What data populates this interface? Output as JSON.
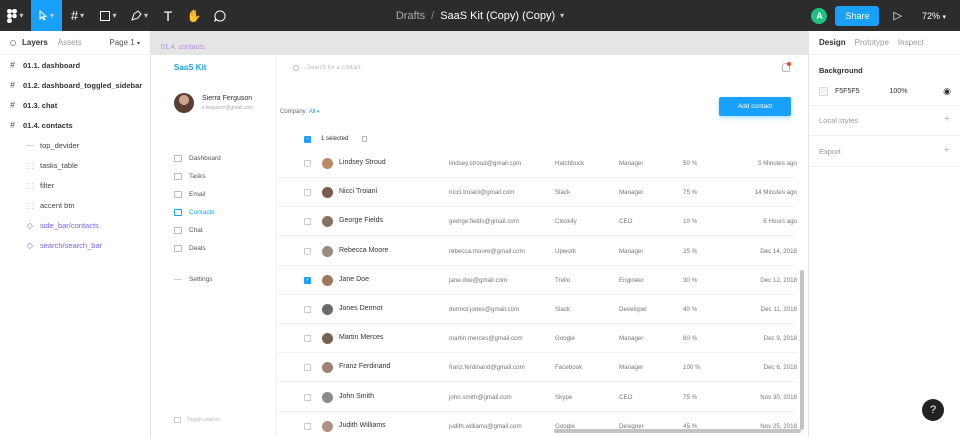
{
  "toolbar": {
    "tools": [
      "figma-menu",
      "move",
      "frame",
      "shape",
      "pen",
      "text",
      "hand",
      "comment"
    ],
    "text_tool_glyph": "T",
    "drafts": "Drafts",
    "separator": "/",
    "file_name": "SaaS Kit (Copy) (Copy)",
    "avatar_letter": "A",
    "share_label": "Share",
    "zoom": "72%"
  },
  "left_panel": {
    "tab_layers": "Layers",
    "tab_assets": "Assets",
    "page": "Page 1",
    "layers": [
      {
        "label": "01.1. dashboard",
        "kind": "frame"
      },
      {
        "label": "01.2. dashboard_toggled_sidebar",
        "kind": "frame"
      },
      {
        "label": "01.3. chat",
        "kind": "frame"
      },
      {
        "label": "01.4. contacts",
        "kind": "frame"
      },
      {
        "label": "top_devider",
        "kind": "line"
      },
      {
        "label": "tasks_table",
        "kind": "group"
      },
      {
        "label": "filter",
        "kind": "group"
      },
      {
        "label": "accent btn",
        "kind": "group"
      },
      {
        "label": "side_bar/contacts",
        "kind": "component"
      },
      {
        "label": "search/search_bar",
        "kind": "component"
      }
    ]
  },
  "canvas": {
    "frame_label": "01.4. contacts",
    "logo": "SaaS Kit",
    "profile": {
      "name": "Sierra Ferguson",
      "email": "s.ferguson@gmail.com"
    },
    "nav": [
      {
        "label": "Dashboard",
        "active": false
      },
      {
        "label": "Tasks",
        "active": false
      },
      {
        "label": "Email",
        "active": false
      },
      {
        "label": "Contacts",
        "active": true
      },
      {
        "label": "Chat",
        "active": false
      },
      {
        "label": "Deals",
        "active": false
      },
      {
        "label": "Settings",
        "active": false
      }
    ],
    "toggle_sidebar": "Toggle sidebar",
    "search_placeholder": "Search for a contact",
    "company_label": "Company:",
    "company_value": "All",
    "add_button": "Add contact",
    "selected_text": "1 selected",
    "contacts": [
      {
        "name": "Lindsey Stroud",
        "email": "lindsey.stroud@gmail.com",
        "company": "Hatchbuck",
        "role": "Manager",
        "percent": "50 %",
        "time": "5 Minutes ago",
        "checked": false,
        "avatar": "#b88a6a"
      },
      {
        "name": "Nicci Troiani",
        "email": "nicci.troiani@gmail.com",
        "company": "Slack",
        "role": "Manager",
        "percent": "75 %",
        "time": "14 Minutes ago",
        "checked": false,
        "avatar": "#7a5c4c"
      },
      {
        "name": "George Fields",
        "email": "george.fields@gmail.com",
        "company": "Clockify",
        "role": "CEO",
        "percent": "10 %",
        "time": "6 Hours ago",
        "checked": false,
        "avatar": "#8a7060"
      },
      {
        "name": "Rebecca Moore",
        "email": "rebecca.moore@gmail.com",
        "company": "Upwork",
        "role": "Manager",
        "percent": "25 %",
        "time": "Dec 14, 2018",
        "checked": false,
        "avatar": "#9a8a80"
      },
      {
        "name": "Jane Doe",
        "email": "jane.doe@gmail.com",
        "company": "Trello",
        "role": "Engineer",
        "percent": "30 %",
        "time": "Dec 12, 2018",
        "checked": true,
        "avatar": "#a07860"
      },
      {
        "name": "Jones Dermot",
        "email": "dermot.jones@gmail.com",
        "company": "Slack",
        "role": "Developer",
        "percent": "40 %",
        "time": "Dec 11, 2018",
        "checked": false,
        "avatar": "#6a6a6a"
      },
      {
        "name": "Martin Merces",
        "email": "martin.merces@gmail.com",
        "company": "Google",
        "role": "Manager",
        "percent": "60 %",
        "time": "Dec 9, 2018",
        "checked": false,
        "avatar": "#7a6050"
      },
      {
        "name": "Franz Ferdinand",
        "email": "franz.ferdinand@gmail.com",
        "company": "Facebook",
        "role": "Manager",
        "percent": "100 %",
        "time": "Dec 6, 2018",
        "checked": false,
        "avatar": "#a08070"
      },
      {
        "name": "John Smith",
        "email": "john.smith@gmail.com",
        "company": "Skype",
        "role": "CEO",
        "percent": "75 %",
        "time": "Nov 30, 2018",
        "checked": false,
        "avatar": "#8a8a8a"
      },
      {
        "name": "Judith Williams",
        "email": "judith.williams@gmail.com",
        "company": "Google",
        "role": "Designer",
        "percent": "45 %",
        "time": "Nov 25, 2018",
        "checked": false,
        "avatar": "#b09080"
      }
    ]
  },
  "right_panel": {
    "tabs": [
      "Design",
      "Prototype",
      "Inspect"
    ],
    "background_title": "Background",
    "background_hex": "F5F5F5",
    "background_opacity": "100%",
    "local_styles": "Local styles",
    "export": "Export",
    "colors": {
      "swatch": "#F5F5F5",
      "accent": "#18a0fb"
    }
  },
  "help": "?"
}
